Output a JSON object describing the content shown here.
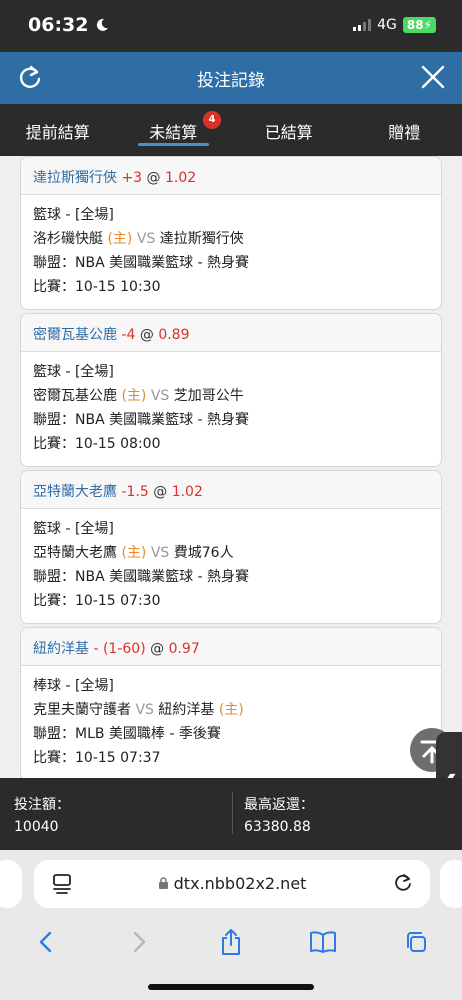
{
  "status": {
    "time": "06:32",
    "network": "4G",
    "battery": "88"
  },
  "header": {
    "title": "投注記錄"
  },
  "tabs": [
    {
      "label": "提前結算"
    },
    {
      "label": "未結算",
      "badge": "4"
    },
    {
      "label": "已結算"
    },
    {
      "label": "贈禮"
    }
  ],
  "bets": [
    {
      "team": "達拉斯獨行俠",
      "handicap": "+3",
      "at": "@",
      "odds": "1.02",
      "sport": "籃球 - [全場]",
      "home": "洛杉磯快艇",
      "home_tag": "(主)",
      "vs": "VS",
      "away": "達拉斯獨行俠",
      "away_tag": "",
      "league": "聯盟：NBA 美國職業籃球 - 熱身賽",
      "match": "比賽：10-15 10:30"
    },
    {
      "team": "密爾瓦基公鹿",
      "handicap": "-4",
      "at": "@",
      "odds": "0.89",
      "sport": "籃球 - [全場]",
      "home": "密爾瓦基公鹿",
      "home_tag": "(主)",
      "vs": "VS",
      "away": "芝加哥公牛",
      "away_tag": "",
      "league": "聯盟：NBA 美國職業籃球 - 熱身賽",
      "match": "比賽：10-15 08:00"
    },
    {
      "team": "亞特蘭大老鷹",
      "handicap": "-1.5",
      "at": "@",
      "odds": "1.02",
      "sport": "籃球 - [全場]",
      "home": "亞特蘭大老鷹",
      "home_tag": "(主)",
      "vs": "VS",
      "away": "費城76人",
      "away_tag": "",
      "league": "聯盟：NBA 美國職業籃球 - 熱身賽",
      "match": "比賽：10-15 07:30"
    },
    {
      "team": "紐約洋基",
      "handicap": "- (1-60)",
      "at": "@",
      "odds": "0.97",
      "sport": "棒球 - [全場]",
      "home": "克里夫蘭守護者",
      "home_tag": "",
      "vs": "VS",
      "away": "紐約洋基",
      "away_tag": "(主)",
      "league": "聯盟：MLB 美國職棒 - 季後賽",
      "match": "比賽：10-15 07:37"
    }
  ],
  "footer": {
    "stake_label": "投注額：",
    "stake_value": "10040",
    "max_return_label": "最高返還：",
    "max_return_value": "63380.88"
  },
  "browser": {
    "url": "dtx.nbb02x2.net"
  }
}
